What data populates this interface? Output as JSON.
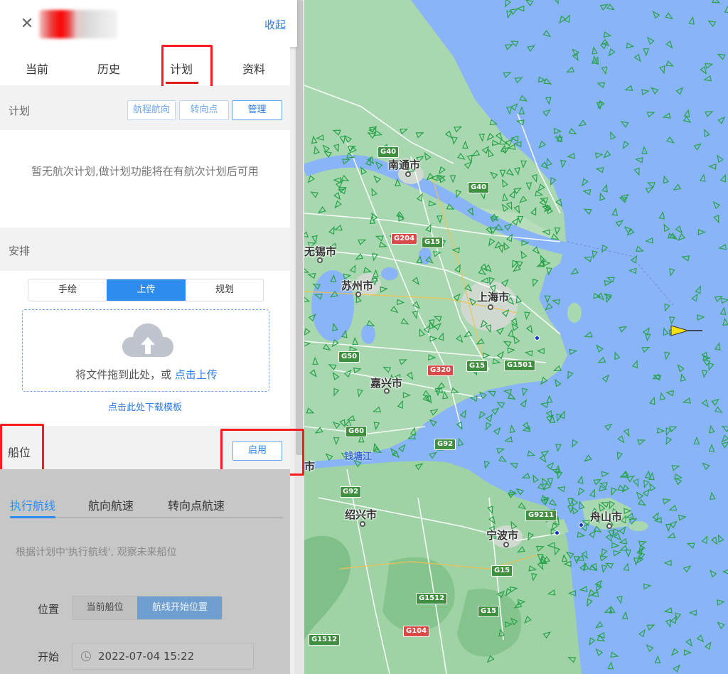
{
  "header": {
    "close_icon": "✕",
    "collapse_label": "收起"
  },
  "tabs": [
    "当前",
    "历史",
    "计划",
    "资料"
  ],
  "active_tab": "计划",
  "plan": {
    "title": "计划",
    "buttons": [
      "航程航向",
      "转向点",
      "管理"
    ],
    "empty_text": "暂无航次计划,做计划功能将在有航次计划后可用"
  },
  "arrange": {
    "title": "安排",
    "modes": [
      "手绘",
      "上传",
      "规划"
    ],
    "active_mode": "上传",
    "upload_text": "将文件拖到此处，或",
    "upload_link": "点击上传",
    "download_template": "点击此处下载模板"
  },
  "berth": {
    "title": "船位",
    "enable_label": "启用",
    "sub_tabs": [
      "执行航线",
      "航向航速",
      "转向点航速"
    ],
    "active_sub_tab": "执行航线",
    "hint": "根据计划中'执行航线', 观察未来船位",
    "position_label": "位置",
    "position_options": [
      "当前船位",
      "航线开始位置"
    ],
    "active_position": "航线开始位置",
    "start_label": "开始",
    "start_value": "2022-07-04 15:22"
  },
  "map": {
    "cities": [
      "南通市",
      "无锡市",
      "苏州市",
      "上海市",
      "嘉兴市",
      "绍兴市",
      "宁波市",
      "舟山市"
    ],
    "fragment_label": "市",
    "river": "钱塘江",
    "roads": [
      "G40",
      "G40",
      "G204",
      "G15",
      "G50",
      "G320",
      "G15",
      "G1501",
      "G60",
      "G92",
      "G92",
      "G9211",
      "G15",
      "G1512",
      "G15",
      "G104",
      "G1512"
    ]
  }
}
